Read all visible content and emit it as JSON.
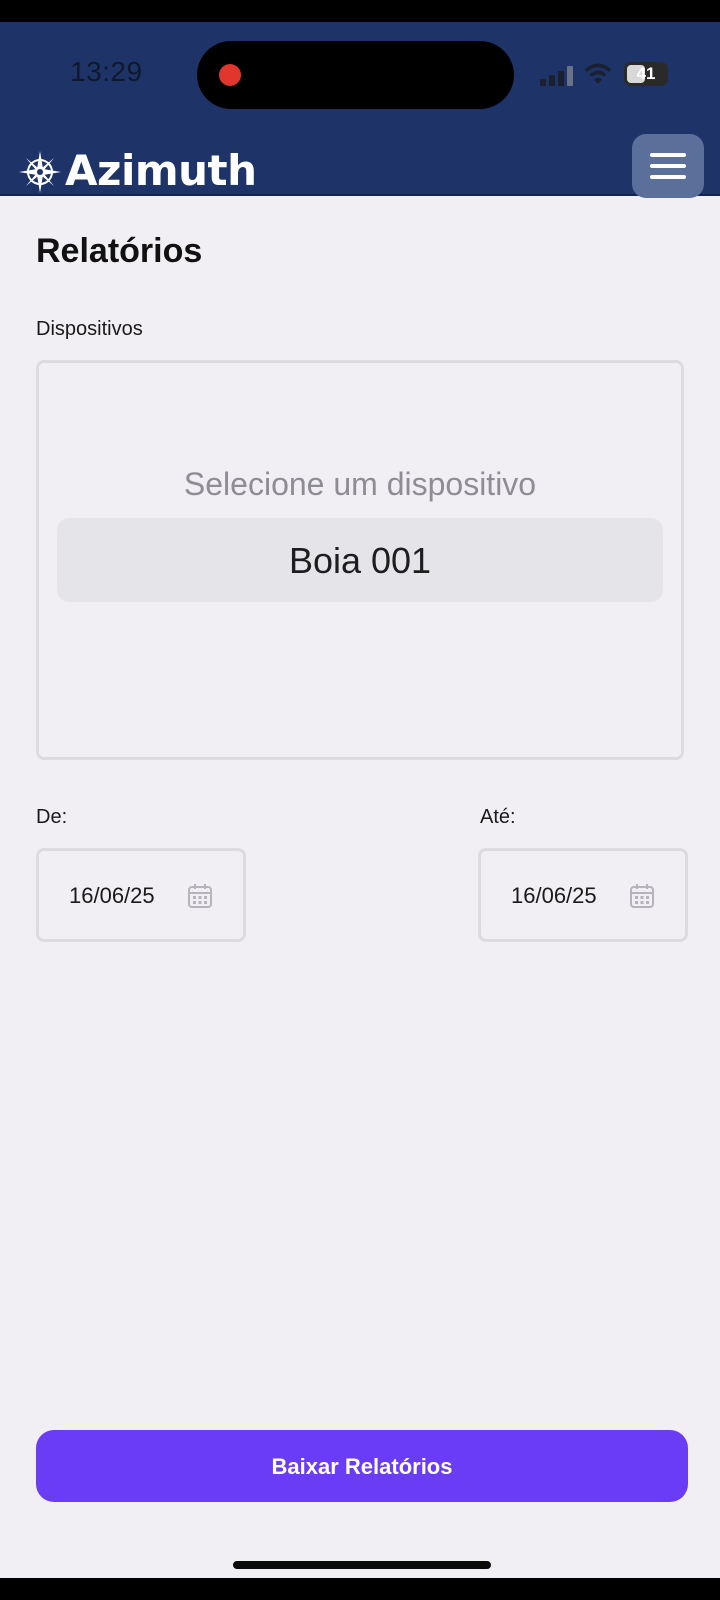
{
  "status_bar": {
    "time": "13:29",
    "battery": "41"
  },
  "header": {
    "brand": "Azimuth",
    "logo_icon": "compass-rose-icon",
    "menu_icon": "hamburger-menu-icon"
  },
  "page": {
    "title": "Relatórios"
  },
  "devices": {
    "label": "Dispositivos",
    "placeholder": "Selecione um dispositivo",
    "selected": "Boia 001"
  },
  "date_range": {
    "from_label": "De:",
    "from_value": "16/06/25",
    "to_label": "Até:",
    "to_value": "16/06/25",
    "icon": "calendar-icon"
  },
  "actions": {
    "download_label": "Baixar Relatórios"
  },
  "colors": {
    "header_bg": "#1e3468",
    "accent": "#6b3cf6",
    "page_bg": "#f1eff3",
    "recording_dot": "#e0362b"
  }
}
